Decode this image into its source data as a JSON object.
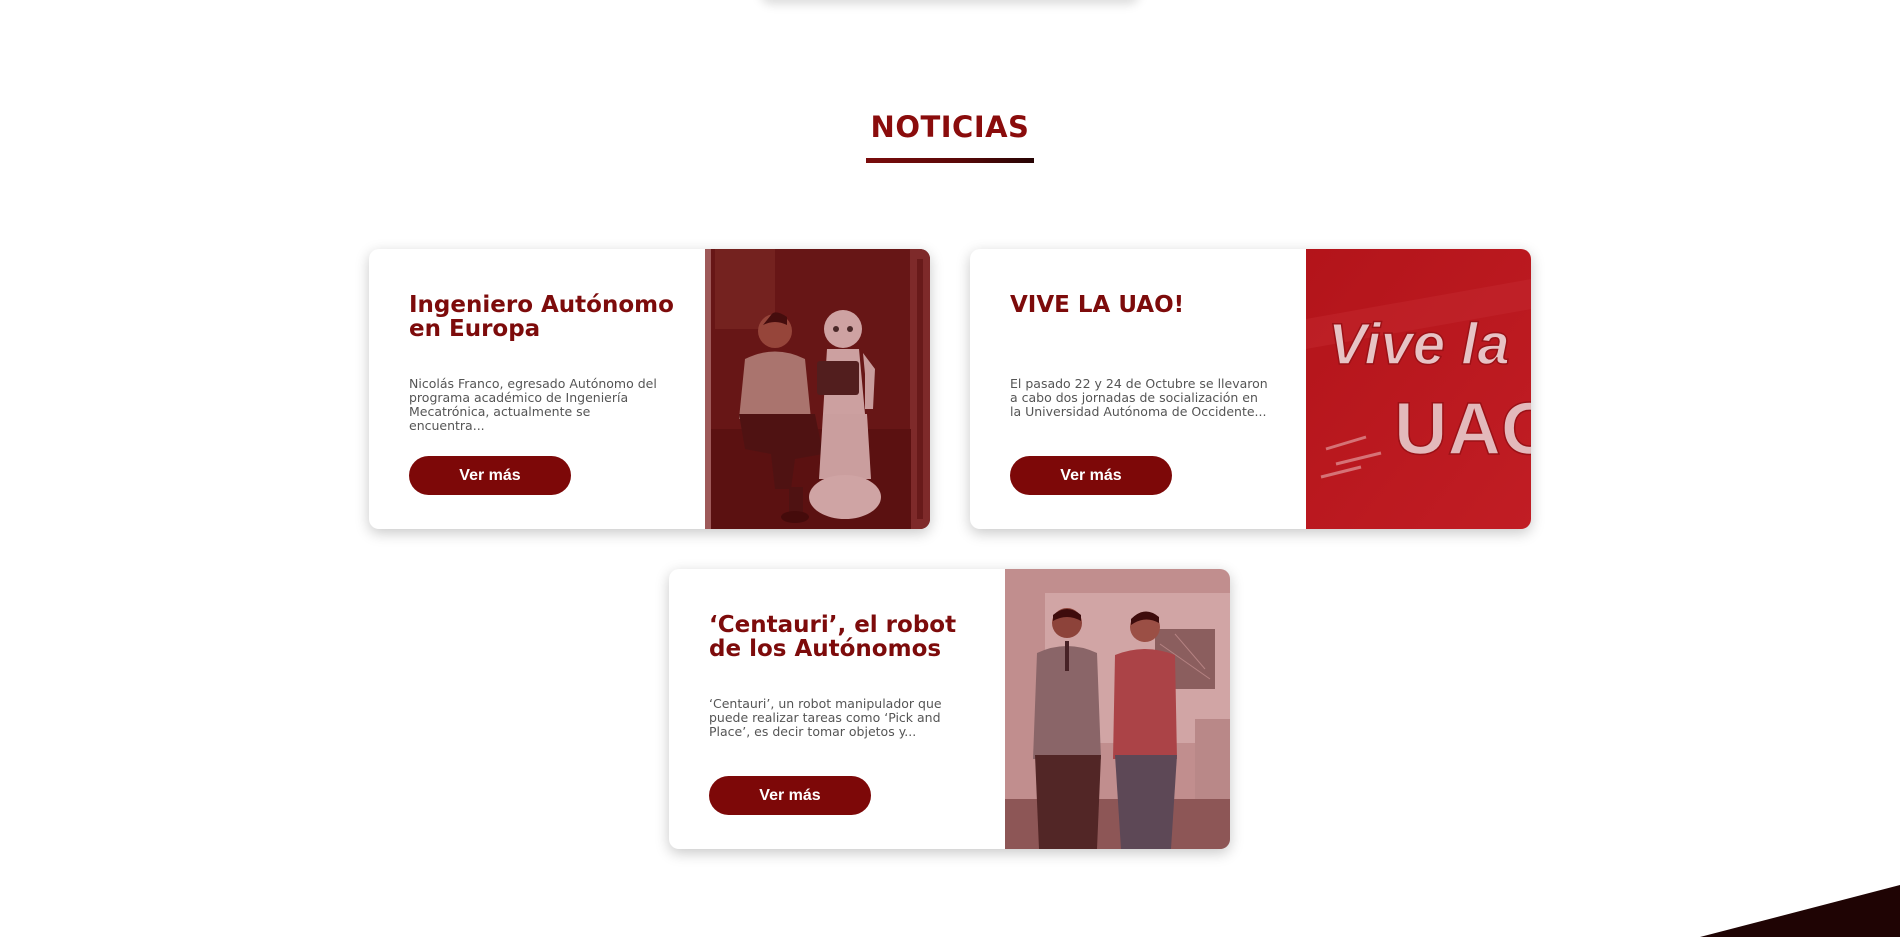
{
  "section": {
    "title": "NOTICIAS"
  },
  "news": [
    {
      "title": "Ingeniero Autónomo en Europa",
      "description": "Nicolás Franco, egresado Autónomo del programa académico de Ingeniería Mecatrónica, actualmente se encuentra...",
      "button_label": "Ver más"
    },
    {
      "title": "VIVE LA UAO!",
      "description": "El pasado 22 y 24 de Octubre se llevaron a cabo dos jornadas de socialización en la Universidad Autónoma de Occidente...",
      "button_label": "Ver más",
      "image_text": {
        "line1": "Vive la",
        "line2": "UAO"
      }
    },
    {
      "title": "‘Centauri’, el robot de los Autónomos",
      "description": "‘Centauri’, un robot manipulador que puede realizar tareas como ‘Pick and Place’, es decir tomar objetos y...",
      "button_label": "Ver más"
    }
  ],
  "colors": {
    "brand": "#7d0b0b",
    "button": "#7d0808",
    "image_overlay": "#8a1010"
  }
}
